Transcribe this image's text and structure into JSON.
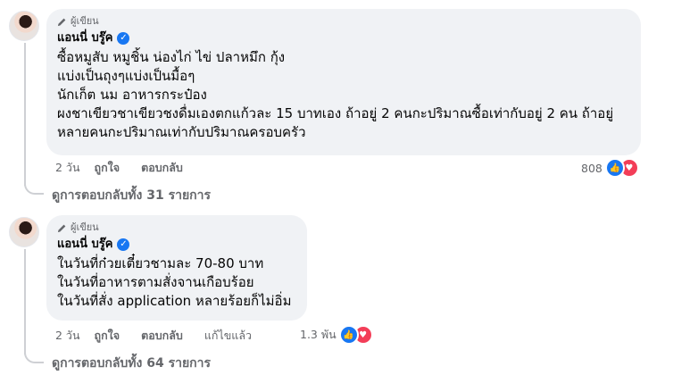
{
  "comments": [
    {
      "author_badge": "ผู้เขียน",
      "author_name": "แอนนี่ บรู๊ค",
      "lines": [
        "ซื้อหมูสับ หมูชิ้น น่องไก่ ไข่ ปลาหมึก กุ้ง",
        "แบ่งเป็นถุงๆแบ่งเป็นมื้อๆ",
        "นักเก็ต นม อาหารกระป๋อง",
        "ผงชาเขียวชาเขียวชงดื่มเองตกแก้วละ 15 บาทเอง ถ้าอยู่ 2 คนกะปริมาณซื้อเท่ากับอยู่ 2 คน ถ้าอยู่",
        "หลายคนกะปริมาณเท่ากับปริมาณครอบครัว"
      ],
      "time": "2 วัน",
      "like_label": "ถูกใจ",
      "reply_label": "ตอบกลับ",
      "reaction_count": "808",
      "view_replies": "ดูการตอบกลับทั้ง 31 รายการ"
    },
    {
      "author_badge": "ผู้เขียน",
      "author_name": "แอนนี่ บรู๊ค",
      "lines": [
        "ในวันที่ก๋วยเตี๋ยวชามละ 70-80 บาท",
        "ในวันที่อาหารตามสั่งจานเกือบร้อย",
        "ในวันที่สั่ง application หลายร้อยก็ไม่อิ่ม"
      ],
      "time": "2 วัน",
      "like_label": "ถูกใจ",
      "reply_label": "ตอบกลับ",
      "edited_label": "แก้ไขแล้ว",
      "reaction_count": "1.3 พัน",
      "view_replies": "ดูการตอบกลับทั้ง 64 รายการ"
    }
  ],
  "icons": {
    "author_badge": "pencil-icon",
    "verified": "verified-badge-icon",
    "like_reaction": "like-reaction-icon",
    "love_reaction": "love-reaction-icon"
  },
  "colors": {
    "bubble": "#f0f2f5",
    "secondary_text": "#65676b",
    "verified": "#1877f2",
    "like": "#1877f2",
    "love": "#f33e58"
  }
}
